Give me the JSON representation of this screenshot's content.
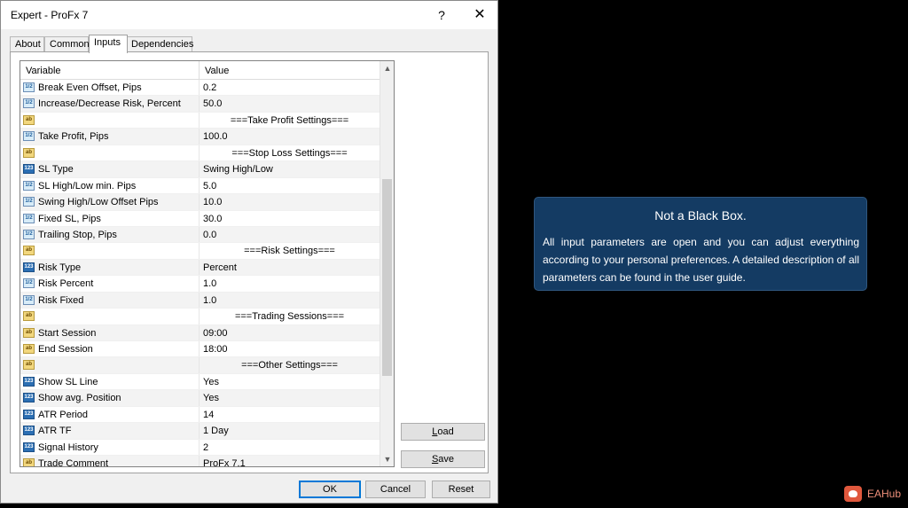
{
  "window": {
    "title": "Expert - ProFx 7",
    "help_glyph": "?",
    "close_glyph": "✕"
  },
  "tabs": [
    {
      "label": "About"
    },
    {
      "label": "Common"
    },
    {
      "label": "Inputs",
      "active": true
    },
    {
      "label": "Dependencies"
    }
  ],
  "grid": {
    "col_variable": "Variable",
    "col_value": "Value",
    "rows": [
      {
        "type": "num",
        "icon": "1/2",
        "name": "Break Even Offset, Pips",
        "value": "0.2"
      },
      {
        "type": "num",
        "icon": "1/2",
        "name": "Increase/Decrease Risk, Percent",
        "value": "50.0"
      },
      {
        "type": "str",
        "icon": "ab",
        "name": "",
        "value": "===Take Profit Settings===",
        "header": true
      },
      {
        "type": "num",
        "icon": "1/2",
        "name": "Take Profit, Pips",
        "value": "100.0"
      },
      {
        "type": "str",
        "icon": "ab",
        "name": "",
        "value": "===Stop Loss Settings===",
        "header": true
      },
      {
        "type": "enum",
        "icon": "123",
        "name": "SL Type",
        "value": "Swing High/Low"
      },
      {
        "type": "num",
        "icon": "1/2",
        "name": "SL High/Low min. Pips",
        "value": "5.0"
      },
      {
        "type": "num",
        "icon": "1/2",
        "name": "Swing High/Low Offset Pips",
        "value": "10.0"
      },
      {
        "type": "num",
        "icon": "1/2",
        "name": "Fixed SL, Pips",
        "value": "30.0"
      },
      {
        "type": "num",
        "icon": "1/2",
        "name": "Trailing Stop, Pips",
        "value": "0.0"
      },
      {
        "type": "str",
        "icon": "ab",
        "name": "",
        "value": "===Risk Settings===",
        "header": true
      },
      {
        "type": "enum",
        "icon": "123",
        "name": "Risk Type",
        "value": "Percent"
      },
      {
        "type": "num",
        "icon": "1/2",
        "name": "Risk Percent",
        "value": "1.0"
      },
      {
        "type": "num",
        "icon": "1/2",
        "name": "Risk Fixed",
        "value": "1.0"
      },
      {
        "type": "str",
        "icon": "ab",
        "name": "",
        "value": "===Trading Sessions===",
        "header": true
      },
      {
        "type": "str",
        "icon": "ab",
        "name": "Start Session",
        "value": "09:00"
      },
      {
        "type": "str",
        "icon": "ab",
        "name": "End Session",
        "value": "18:00"
      },
      {
        "type": "str",
        "icon": "ab",
        "name": "",
        "value": "===Other Settings===",
        "header": true
      },
      {
        "type": "enum",
        "icon": "123",
        "name": "Show SL Line",
        "value": "Yes"
      },
      {
        "type": "enum",
        "icon": "123",
        "name": "Show avg. Position",
        "value": "Yes"
      },
      {
        "type": "enum",
        "icon": "123",
        "name": "ATR Period",
        "value": "14"
      },
      {
        "type": "enum",
        "icon": "123",
        "name": "ATR TF",
        "value": "1 Day"
      },
      {
        "type": "enum",
        "icon": "123",
        "name": "Signal History",
        "value": "2"
      },
      {
        "type": "str",
        "icon": "ab",
        "name": "Trade Comment",
        "value": "ProFx 7.1"
      }
    ],
    "scroll_up": "▲",
    "scroll_down": "▼"
  },
  "buttons": {
    "load": "Load",
    "save": "Save",
    "ok": "OK",
    "cancel": "Cancel",
    "reset": "Reset"
  },
  "info_box": {
    "heading": "Not a Black Box.",
    "body": "All input parameters are open and you can adjust everything according to your personal preferences. A detailed description of all parameters can be found in the user guide."
  },
  "brand": {
    "name": "EAHub"
  },
  "colors": {
    "info_bg": "#143b63",
    "brand_accent": "#e0583d",
    "default_button_border": "#0078d7"
  }
}
